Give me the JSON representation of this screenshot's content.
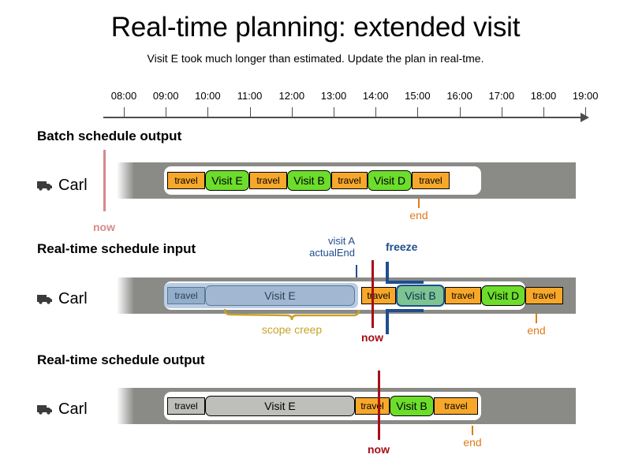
{
  "title": "Real-time planning: extended visit",
  "subtitle": "Visit E took much longer than estimated. Update the plan in real-tme.",
  "axis": {
    "ticks": [
      "08:00",
      "09:00",
      "10:00",
      "11:00",
      "12:00",
      "13:00",
      "14:00",
      "15:00",
      "16:00",
      "17:00",
      "18:00",
      "19:00"
    ]
  },
  "colors": {
    "travel": "#f7a82a",
    "visit": "#6ddd2c",
    "past": "#bebeba",
    "pinned": "#b9cde6",
    "frozen_border": "#1f4e8c",
    "now_faded": "#d88a8a",
    "now_active": "#a50f16",
    "end": "#e07b19",
    "scope_creep": "#c9a227",
    "band": "#8a8a87"
  },
  "sections": [
    {
      "heading": "Batch schedule output",
      "vehicle": "Carl",
      "vehicle_icon": "truck-icon",
      "now": {
        "label": "now",
        "state": "faded"
      },
      "end": {
        "label": "end"
      },
      "blocks": [
        {
          "label": "travel",
          "kind": "travel"
        },
        {
          "label": "Visit E",
          "kind": "visit"
        },
        {
          "label": "travel",
          "kind": "travel"
        },
        {
          "label": "Visit B",
          "kind": "visit"
        },
        {
          "label": "travel",
          "kind": "travel"
        },
        {
          "label": "Visit D",
          "kind": "visit"
        },
        {
          "label": "travel",
          "kind": "travel"
        }
      ]
    },
    {
      "heading": "Real-time schedule input",
      "vehicle": "Carl",
      "vehicle_icon": "truck-icon",
      "now": {
        "label": "now",
        "state": "active"
      },
      "end": {
        "label": "end"
      },
      "visit_a_actual_end": {
        "line1": "visit A",
        "line2": "actualEnd"
      },
      "freeze": {
        "label": "freeze"
      },
      "scope_creep": {
        "label": "scope creep"
      },
      "blocks": [
        {
          "label": "travel",
          "kind": "pin-travel"
        },
        {
          "label": "Visit E",
          "kind": "pin-visit"
        },
        {
          "label": "travel",
          "kind": "travel"
        },
        {
          "label": "Visit B",
          "kind": "frozen-visit"
        },
        {
          "label": "travel",
          "kind": "travel"
        },
        {
          "label": "Visit D",
          "kind": "visit"
        },
        {
          "label": "travel",
          "kind": "travel"
        }
      ]
    },
    {
      "heading": "Real-time schedule output",
      "vehicle": "Carl",
      "vehicle_icon": "truck-icon",
      "now": {
        "label": "now",
        "state": "active"
      },
      "end": {
        "label": "end"
      },
      "blocks": [
        {
          "label": "travel",
          "kind": "past-travel"
        },
        {
          "label": "Visit E",
          "kind": "past-visit"
        },
        {
          "label": "travel",
          "kind": "travel"
        },
        {
          "label": "Visit B",
          "kind": "visit"
        },
        {
          "label": "travel",
          "kind": "travel"
        }
      ]
    }
  ]
}
